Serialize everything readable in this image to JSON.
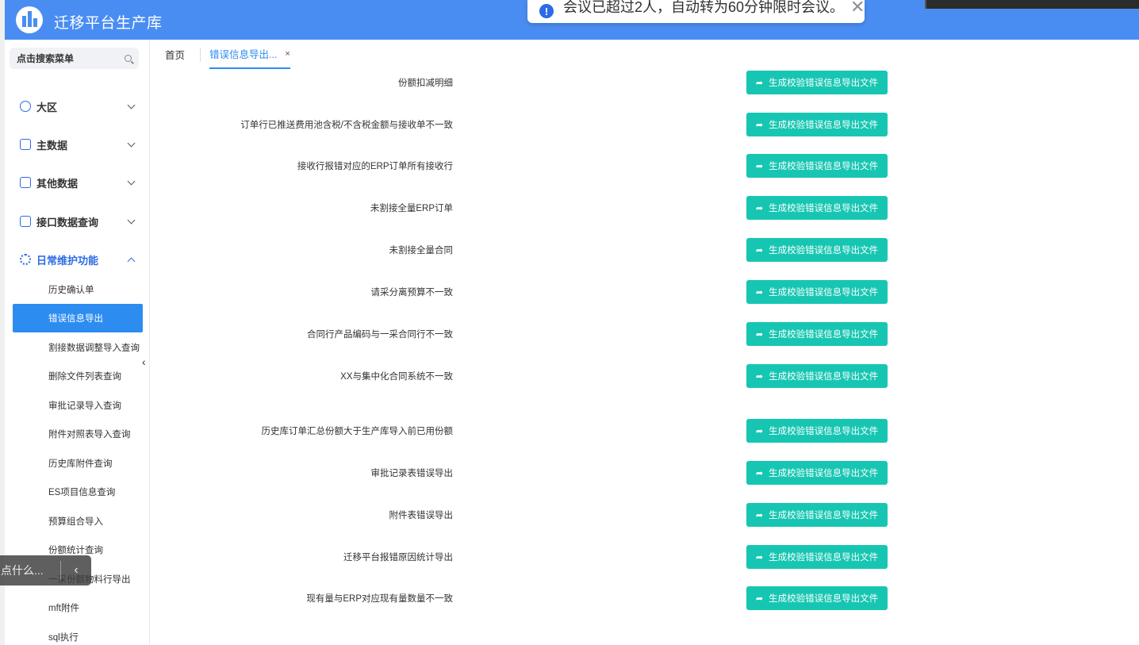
{
  "app": {
    "title": "迁移平台生产库"
  },
  "toast": {
    "icon": "info-icon",
    "icon_glyph": "!",
    "message": "会议已超过2人，自动转为60分钟限时会议。",
    "close": "✕"
  },
  "sidebar": {
    "search_placeholder": "点击搜索菜单",
    "groups": [
      {
        "label": "大区",
        "icon": "region-icon"
      },
      {
        "label": "主数据",
        "icon": "master-data-icon"
      },
      {
        "label": "其他数据",
        "icon": "other-data-icon"
      },
      {
        "label": "接口数据查询",
        "icon": "interface-icon"
      },
      {
        "label": "日常维护功能",
        "icon": "gear-icon"
      }
    ],
    "sub_items": [
      "历史确认单",
      "错误信息导出",
      "割接数据调整导入查询",
      "删除文件列表查询",
      "审批记录导入查询",
      "附件对照表导入查询",
      "历史库附件查询",
      "ES项目信息查询",
      "预算组合导入",
      "份额统计查询",
      "一采份额物料行导出",
      "mft附件",
      "sql执行"
    ],
    "collapse_glyph": "‹"
  },
  "float_tool": {
    "text": "点什么...",
    "arrow": "‹"
  },
  "tabs": {
    "home": "首页",
    "active": "错误信息导出...",
    "close": "×"
  },
  "rows": [
    {
      "label": "份额扣减明细",
      "button": "生成校验错误信息导出文件"
    },
    {
      "label": "订单行已推送费用池含税/不含税金额与接收单不一致",
      "button": "生成校验错误信息导出文件"
    },
    {
      "label": "接收行报错对应的ERP订单所有接收行",
      "button": "生成校验错误信息导出文件"
    },
    {
      "label": "未割接全量ERP订单",
      "button": "生成校验错误信息导出文件"
    },
    {
      "label": "未割接全量合同",
      "button": "生成校验错误信息导出文件"
    },
    {
      "label": "请采分离预算不一致",
      "button": "生成校验错误信息导出文件"
    },
    {
      "label": "合同行产品编码与一采合同行不一致",
      "button": "生成校验错误信息导出文件"
    },
    {
      "label": "XX与集中化合同系统不一致",
      "button": "生成校验错误信息导出文件"
    },
    {
      "label": "历史库订单汇总份额大于生产库导入前已用份额",
      "button": "生成校验错误信息导出文件"
    },
    {
      "label": "审批记录表错误导出",
      "button": "生成校验错误信息导出文件"
    },
    {
      "label": "附件表错误导出",
      "button": "生成校验错误信息导出文件"
    },
    {
      "label": "迁移平台报错原因统计导出",
      "button": "生成校验错误信息导出文件"
    },
    {
      "label": "现有量与ERP对应现有量数量不一致",
      "button": "生成校验错误信息导出文件"
    }
  ],
  "button_icon": "share-arrow-icon",
  "button_glyph": "➦",
  "colors": {
    "header": "#4a8df2",
    "accent": "#2d8cf0",
    "button": "#17c6b2"
  }
}
